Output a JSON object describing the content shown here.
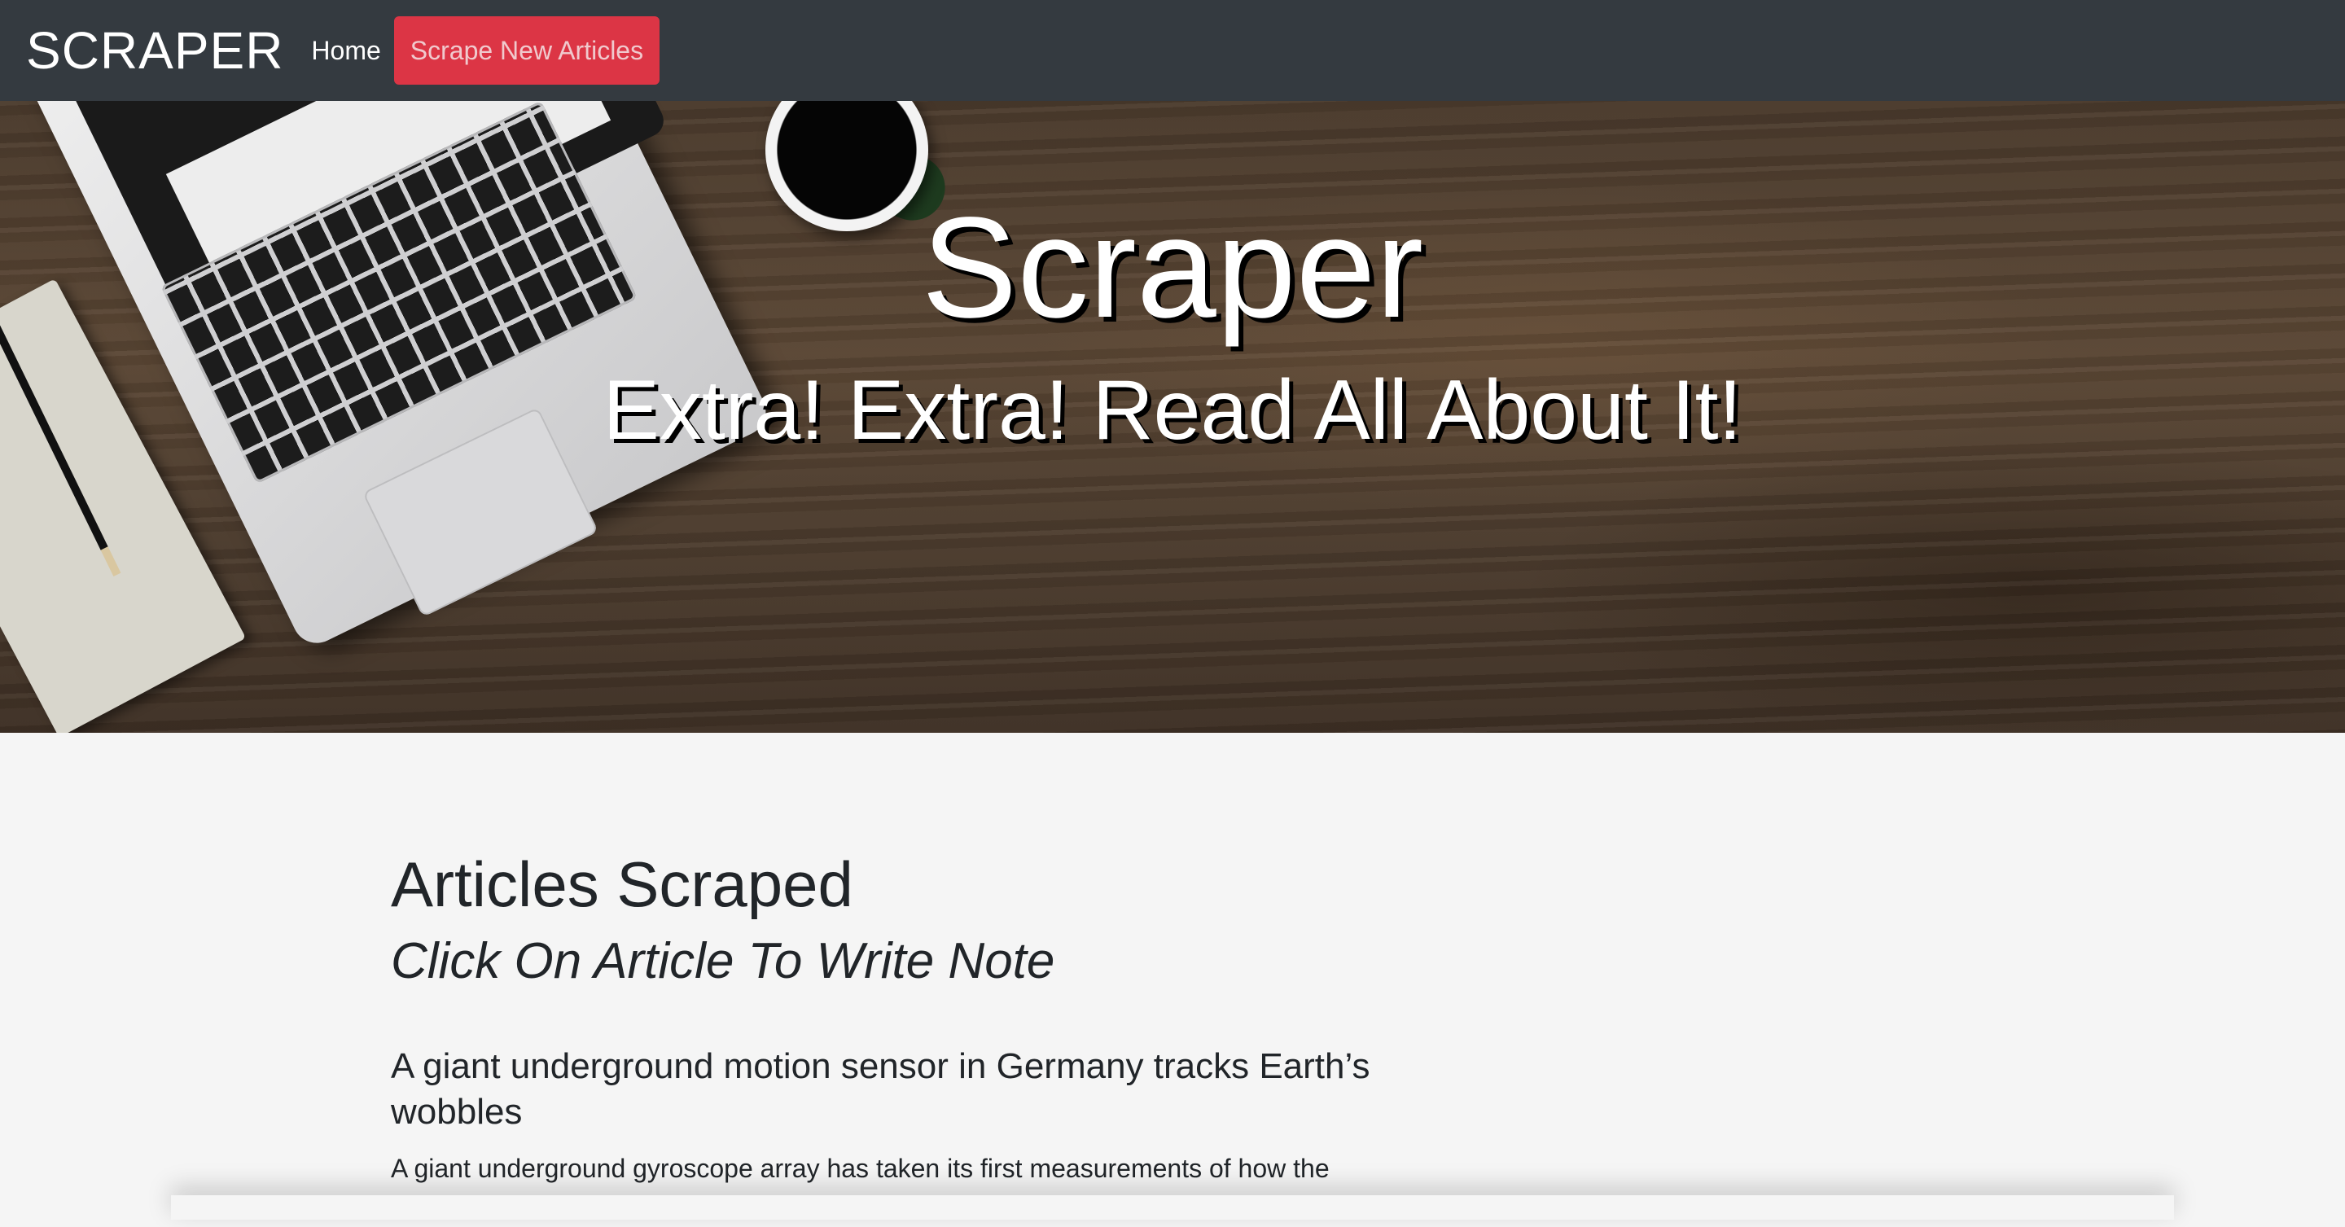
{
  "navbar": {
    "brand": "SCRAPER",
    "home_label": "Home",
    "scrape_button_label": "Scrape New Articles",
    "background": "#343a40",
    "button_color": "#dc3545"
  },
  "hero": {
    "title": "Scraper",
    "subtitle": "Extra! Extra! Read All About It!"
  },
  "main": {
    "title": "Articles Scraped",
    "subtitle": "Click On Article To Write Note",
    "articles": [
      {
        "title": "A giant underground motion sensor in Germany tracks Earth’s wobbles",
        "summary": "A giant underground gyroscope array has taken its first measurements of how the world turns in a wobble."
      }
    ]
  }
}
